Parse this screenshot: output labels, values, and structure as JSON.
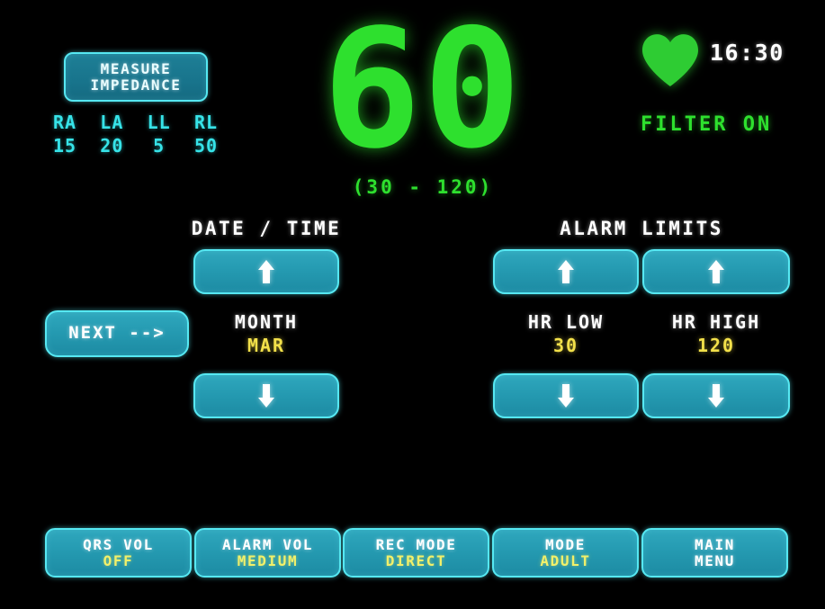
{
  "device": {
    "measure_impedance": {
      "line1": "MEASURE",
      "line2": "IMPEDANCE"
    },
    "electrodes": [
      {
        "name": "RA",
        "value": "15"
      },
      {
        "name": "LA",
        "value": "20"
      },
      {
        "name": "LL",
        "value": "5"
      },
      {
        "name": "RL",
        "value": "50"
      }
    ],
    "heart_rate": {
      "value": "60",
      "range": "(30 - 120)"
    },
    "status": {
      "clock": "16:30",
      "filter": "FILTER ON",
      "heart_icon": "heart-icon"
    }
  },
  "date_time": {
    "title": "DATE / TIME",
    "up_icon": "arrow-up-icon",
    "down_icon": "arrow-down-icon",
    "field_name": "MONTH",
    "field_value": "MAR"
  },
  "alarm_limits": {
    "title": "ALARM LIMITS",
    "fields": [
      {
        "name": "HR LOW",
        "value": "30",
        "up_icon": "arrow-up-icon",
        "down_icon": "arrow-down-icon"
      },
      {
        "name": "HR HIGH",
        "value": "120",
        "up_icon": "arrow-up-icon",
        "down_icon": "arrow-down-icon"
      }
    ]
  },
  "next_button": {
    "label": "NEXT -->"
  },
  "softkeys": [
    {
      "line1": "QRS VOL",
      "line2": "OFF",
      "value_white": false
    },
    {
      "line1": "ALARM VOL",
      "line2": "MEDIUM",
      "value_white": false
    },
    {
      "line1": "REC MODE",
      "line2": "DIRECT",
      "value_white": false
    },
    {
      "line1": "MODE",
      "line2": "ADULT",
      "value_white": false
    },
    {
      "line1": "MAIN",
      "line2": "MENU",
      "value_white": true
    }
  ],
  "colors": {
    "background": "#000000",
    "button_fill": "#2499b0",
    "button_border": "#56e8f2",
    "accent_green": "#2ee02e",
    "accent_cyan": "#36e3e8",
    "accent_yellow": "#f2e04a",
    "text_white": "#ffffff"
  }
}
